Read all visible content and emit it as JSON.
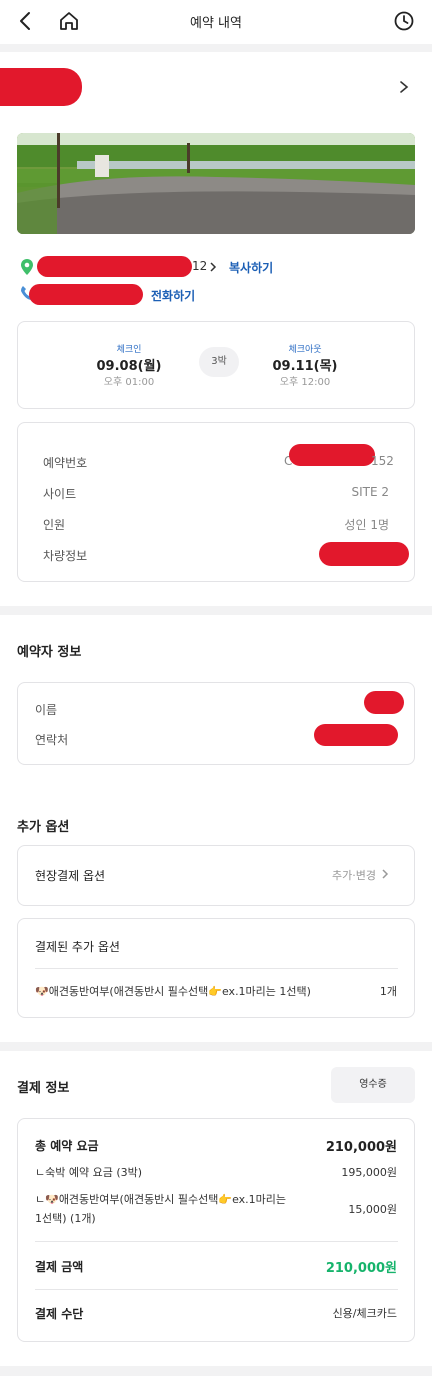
{
  "header": {
    "title": "예약 내역"
  },
  "camp": {
    "address_suffix": "12",
    "copy_label": "복사하기",
    "call_label": "전화하기"
  },
  "stay": {
    "checkin_label": "체크인",
    "checkin_date": "09.08(월)",
    "checkin_time": "오후 01:00",
    "nights": "3박",
    "checkout_label": "체크아웃",
    "checkout_date": "09.11(목)",
    "checkout_time": "오후 12:00"
  },
  "reservation": {
    "rows": [
      {
        "label": "예약번호",
        "value": "C",
        "value_suffix": "152"
      },
      {
        "label": "사이트",
        "value": "SITE 2"
      },
      {
        "label": "인원",
        "value": "성인 1명"
      },
      {
        "label": "차량정보",
        "value": ""
      }
    ]
  },
  "booker": {
    "title": "예약자 정보",
    "name_label": "이름",
    "contact_label": "연락처"
  },
  "options": {
    "title": "추가 옵션",
    "onsite_label": "현장결제 옵션",
    "onsite_action": "추가·변경",
    "paid_title": "결제된 추가 옵션",
    "paid_item": "🐶애견동반여부(애견동반시 필수선택👉ex.1마리는 1선택)",
    "paid_qty": "1개"
  },
  "payment": {
    "title": "결제 정보",
    "receipt_label": "영수증",
    "total_label": "총 예약 요금",
    "total_value": "210,000원",
    "stay_label": "ㄴ숙박 예약 요금 (3박)",
    "stay_value": "195,000원",
    "pet_label_line1": "ㄴ🐶애견동반여부(애견동반시 필수선택👉ex.1마리는",
    "pet_label_line2": "1선택) (1개)",
    "pet_value": "15,000원",
    "amount_label": "결제 금액",
    "amount_value": "210,000원",
    "method_label": "결제 수단",
    "method_value": "신용/체크카드"
  },
  "colors": {
    "accent_green": "#16b36b",
    "link_blue": "#1c5fb5",
    "redaction": "#e2182c",
    "divider": "#f2f2f3"
  }
}
